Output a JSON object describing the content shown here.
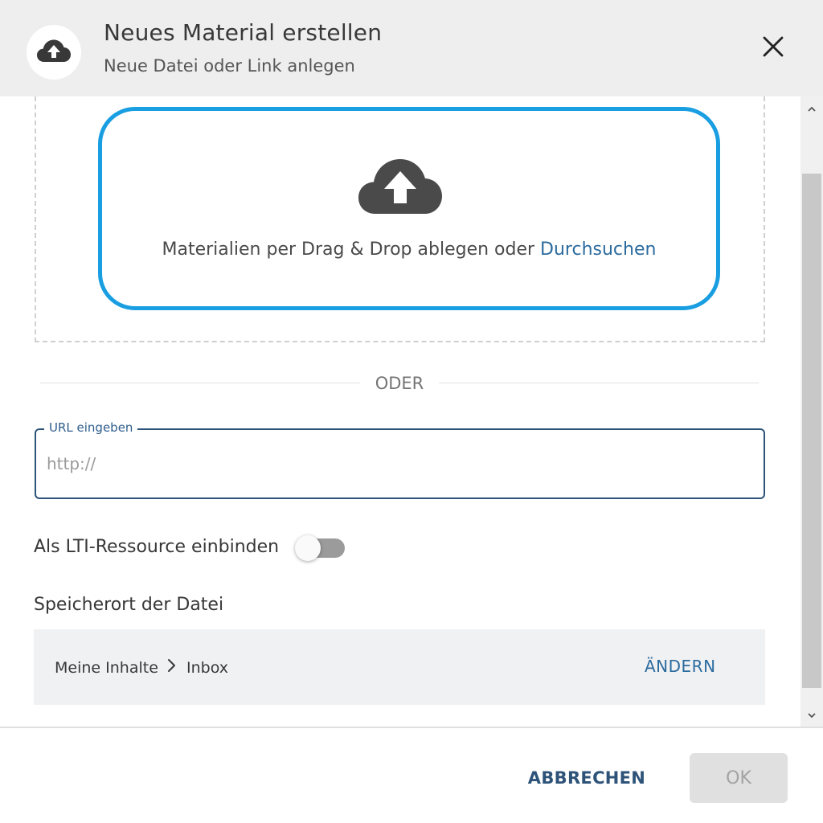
{
  "header": {
    "title": "Neues Material erstellen",
    "subtitle": "Neue Datei oder Link anlegen",
    "icon": "cloud-upload-icon",
    "close_icon": "close-icon"
  },
  "dropzone": {
    "icon": "cloud-upload-icon",
    "text": "Materialien per Drag & Drop ablegen oder ",
    "browse_link": "Durchsuchen"
  },
  "divider": {
    "text": "ODER"
  },
  "url": {
    "label": "URL eingeben",
    "placeholder": "http://",
    "value": ""
  },
  "lti": {
    "label": "Als LTI-Ressource einbinden",
    "enabled": false
  },
  "location": {
    "label": "Speicherort der Datei",
    "breadcrumb": [
      "Meine Inhalte",
      "Inbox"
    ],
    "change_label": "ÄNDERN"
  },
  "footer": {
    "cancel_label": "ABBRECHEN",
    "ok_label": "OK",
    "ok_disabled": true
  },
  "colors": {
    "accent": "#1a9ee2",
    "primary": "#2e5379",
    "link": "#2c6b9e",
    "header_bg": "#eeeeee"
  }
}
